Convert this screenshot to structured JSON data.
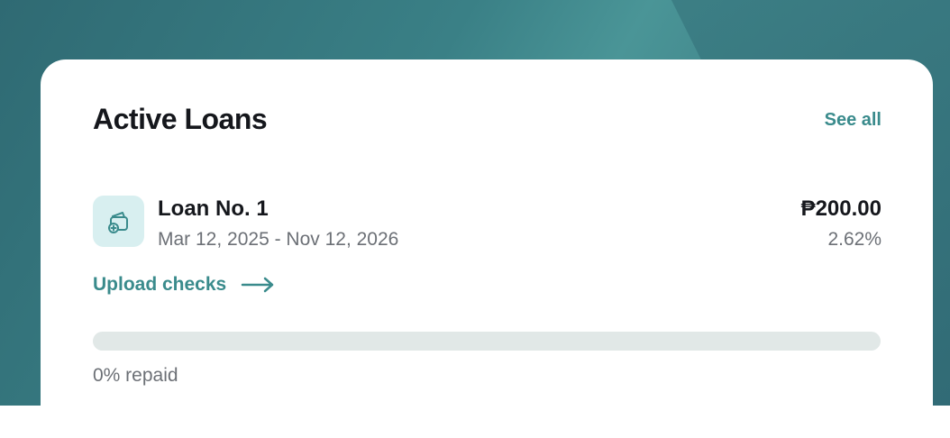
{
  "section": {
    "title": "Active Loans",
    "see_all_label": "See all"
  },
  "loan": {
    "icon": "wallet-plus-icon",
    "name": "Loan No. 1",
    "dates": "Mar 12, 2025 - Nov 12, 2026",
    "amount": "₱200.00",
    "rate": "2.62%",
    "upload_label": "Upload checks",
    "progress_fraction": 0,
    "progress_label": "0% repaid"
  },
  "colors": {
    "accent": "#3a8b8c",
    "icon_bg": "#d8eff0",
    "track": "#e1e8e7",
    "text_primary": "#15171c",
    "text_secondary": "#6c7076"
  }
}
